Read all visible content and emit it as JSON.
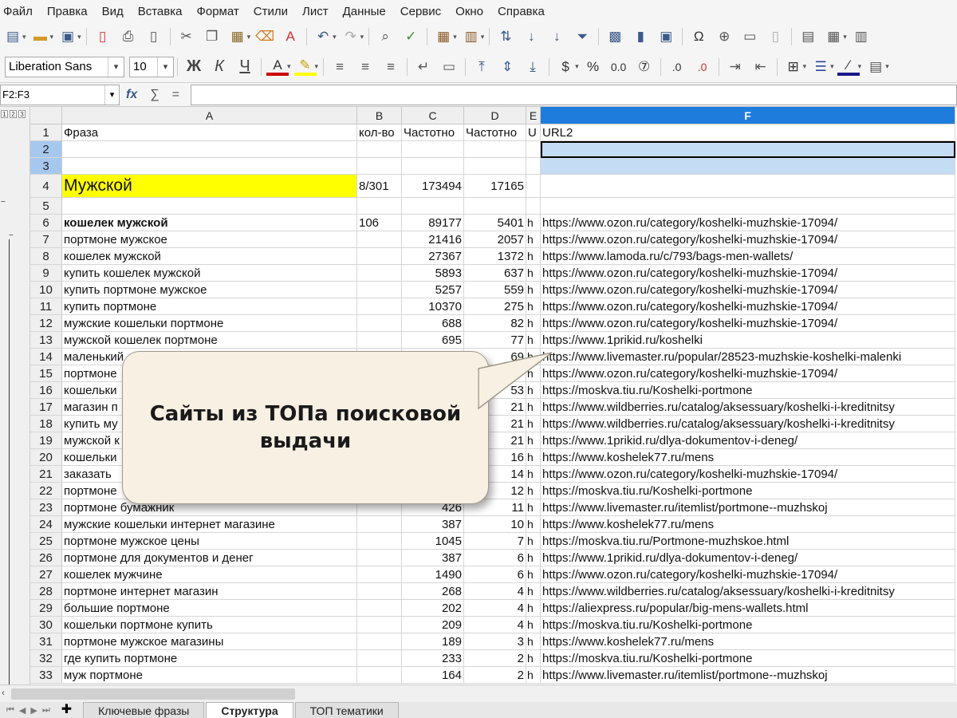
{
  "menu": [
    "Файл",
    "Правка",
    "Вид",
    "Вставка",
    "Формат",
    "Стили",
    "Лист",
    "Данные",
    "Сервис",
    "Окно",
    "Справка"
  ],
  "toolbar": {
    "font_name": "Liberation Sans",
    "font_size": "10",
    "bold": "Ж",
    "italic": "К",
    "underline": "Ч",
    "currency": "$",
    "percent": "%",
    "number": "0.0",
    "fx": "fx",
    "sum": "∑",
    "equals": "="
  },
  "formula": {
    "name_box": "F2:F3",
    "content": ""
  },
  "columns": [
    {
      "id": "A",
      "label": "A"
    },
    {
      "id": "B",
      "label": "B"
    },
    {
      "id": "C",
      "label": "C"
    },
    {
      "id": "D",
      "label": "D"
    },
    {
      "id": "E",
      "label": "E"
    },
    {
      "id": "F",
      "label": "F"
    }
  ],
  "rows": [
    {
      "n": "1",
      "a": "Фраза",
      "b": "кол-во",
      "c": "Частотно",
      "d": "Частотно",
      "e": "U",
      "f": "URL2"
    },
    {
      "n": "2",
      "a": "",
      "b": "",
      "c": "",
      "d": "",
      "e": "",
      "f": ""
    },
    {
      "n": "3",
      "a": "",
      "b": "",
      "c": "",
      "d": "",
      "e": "",
      "f": ""
    },
    {
      "n": "4",
      "a": "Мужской",
      "b": "8/301",
      "c": "173494",
      "d": "17165",
      "e": "",
      "f": ""
    },
    {
      "n": "5",
      "a": "",
      "b": "",
      "c": "",
      "d": "",
      "e": "",
      "f": ""
    },
    {
      "n": "6",
      "a": "кошелек мужской",
      "b": "106",
      "c": "89177",
      "d": "5401",
      "e": "h",
      "f": "https://www.ozon.ru/category/koshelki-muzhskie-17094/"
    },
    {
      "n": "7",
      "a": "портмоне мужское",
      "b": "",
      "c": "21416",
      "d": "2057",
      "e": "h",
      "f": "https://www.ozon.ru/category/koshelki-muzhskie-17094/"
    },
    {
      "n": "8",
      "a": "кошелек мужской",
      "b": "",
      "c": "27367",
      "d": "1372",
      "e": "h",
      "f": "https://www.lamoda.ru/c/793/bags-men-wallets/"
    },
    {
      "n": "9",
      "a": "купить кошелек мужской",
      "b": "",
      "c": "5893",
      "d": "637",
      "e": "h",
      "f": "https://www.ozon.ru/category/koshelki-muzhskie-17094/"
    },
    {
      "n": "10",
      "a": "купить портмоне мужское",
      "b": "",
      "c": "5257",
      "d": "559",
      "e": "h",
      "f": "https://www.ozon.ru/category/koshelki-muzhskie-17094/"
    },
    {
      "n": "11",
      "a": "купить портмоне",
      "b": "",
      "c": "10370",
      "d": "275",
      "e": "h",
      "f": "https://www.ozon.ru/category/koshelki-muzhskie-17094/"
    },
    {
      "n": "12",
      "a": "мужские кошельки портмоне",
      "b": "",
      "c": "688",
      "d": "82",
      "e": "h",
      "f": "https://www.ozon.ru/category/koshelki-muzhskie-17094/"
    },
    {
      "n": "13",
      "a": "мужской кошелек портмоне",
      "b": "",
      "c": "695",
      "d": "77",
      "e": "h",
      "f": "https://www.1prikid.ru/koshelki"
    },
    {
      "n": "14",
      "a": "маленький",
      "b": "",
      "c": "",
      "d": "69",
      "e": "h",
      "f": "https://www.livemaster.ru/popular/28523-muzhskie-koshelki-malenki"
    },
    {
      "n": "15",
      "a": "портмоне",
      "b": "",
      "c": "",
      "d": "",
      "e": "h",
      "f": "https://www.ozon.ru/category/koshelki-muzhskie-17094/"
    },
    {
      "n": "16",
      "a": "кошельки",
      "b": "",
      "c": "",
      "d": "53",
      "e": "h",
      "f": "https://moskva.tiu.ru/Koshelki-portmone"
    },
    {
      "n": "17",
      "a": "магазин п",
      "b": "",
      "c": "",
      "d": "21",
      "e": "h",
      "f": "https://www.wildberries.ru/catalog/aksessuary/koshelki-i-kreditnitsy"
    },
    {
      "n": "18",
      "a": "купить му",
      "b": "",
      "c": "",
      "d": "21",
      "e": "h",
      "f": "https://www.wildberries.ru/catalog/aksessuary/koshelki-i-kreditnitsy"
    },
    {
      "n": "19",
      "a": "мужской к",
      "b": "",
      "c": "",
      "d": "21",
      "e": "h",
      "f": "https://www.1prikid.ru/dlya-dokumentov-i-deneg/"
    },
    {
      "n": "20",
      "a": "кошельки",
      "b": "",
      "c": "",
      "d": "16",
      "e": "h",
      "f": "https://www.koshelek77.ru/mens"
    },
    {
      "n": "21",
      "a": "заказать",
      "b": "",
      "c": "",
      "d": "14",
      "e": "h",
      "f": "https://www.ozon.ru/category/koshelki-muzhskie-17094/"
    },
    {
      "n": "22",
      "a": "портмоне",
      "b": "",
      "c": "",
      "d": "12",
      "e": "h",
      "f": "https://moskva.tiu.ru/Koshelki-portmone"
    },
    {
      "n": "23",
      "a": "портмоне бумажник",
      "b": "",
      "c": "426",
      "d": "11",
      "e": "h",
      "f": "https://www.livemaster.ru/itemlist/portmone--muzhskoj"
    },
    {
      "n": "24",
      "a": "мужские кошельки интернет магазине",
      "b": "",
      "c": "387",
      "d": "10",
      "e": "h",
      "f": "https://www.koshelek77.ru/mens"
    },
    {
      "n": "25",
      "a": "портмоне мужское цены",
      "b": "",
      "c": "1045",
      "d": "7",
      "e": "h",
      "f": "https://moskva.tiu.ru/Portmone-muzhskoe.html"
    },
    {
      "n": "26",
      "a": "портмоне для документов и денег",
      "b": "",
      "c": "387",
      "d": "6",
      "e": "h",
      "f": "https://www.1prikid.ru/dlya-dokumentov-i-deneg/"
    },
    {
      "n": "27",
      "a": "кошелек мужчине",
      "b": "",
      "c": "1490",
      "d": "6",
      "e": "h",
      "f": "https://www.ozon.ru/category/koshelki-muzhskie-17094/"
    },
    {
      "n": "28",
      "a": "портмоне интернет магазин",
      "b": "",
      "c": "268",
      "d": "4",
      "e": "h",
      "f": "https://www.wildberries.ru/catalog/aksessuary/koshelki-i-kreditnitsy"
    },
    {
      "n": "29",
      "a": "большие портмоне",
      "b": "",
      "c": "202",
      "d": "4",
      "e": "h",
      "f": "https://aliexpress.ru/popular/big-mens-wallets.html"
    },
    {
      "n": "30",
      "a": "кошельки портмоне купить",
      "b": "",
      "c": "209",
      "d": "4",
      "e": "h",
      "f": "https://moskva.tiu.ru/Koshelki-portmone"
    },
    {
      "n": "31",
      "a": "портмоне мужское магазины",
      "b": "",
      "c": "189",
      "d": "3",
      "e": "h",
      "f": "https://www.koshelek77.ru/mens"
    },
    {
      "n": "32",
      "a": "где купить портмоне",
      "b": "",
      "c": "233",
      "d": "2",
      "e": "h",
      "f": "https://moskva.tiu.ru/Koshelki-portmone"
    },
    {
      "n": "33",
      "a": "муж портмоне",
      "b": "",
      "c": "164",
      "d": "2",
      "e": "h",
      "f": "https://www.livemaster.ru/itemlist/portmone--muzhskoj"
    }
  ],
  "callout": {
    "text": "Сайты из ТОПа поисковой выдачи"
  },
  "sheet_tabs": [
    "Ключевые фразы",
    "Структура",
    "ТОП тематики"
  ],
  "active_tab": "Структура",
  "colors": {
    "accent": "#1e7ddc",
    "highlight": "#ffff00",
    "selection": "#c5dcf5"
  }
}
